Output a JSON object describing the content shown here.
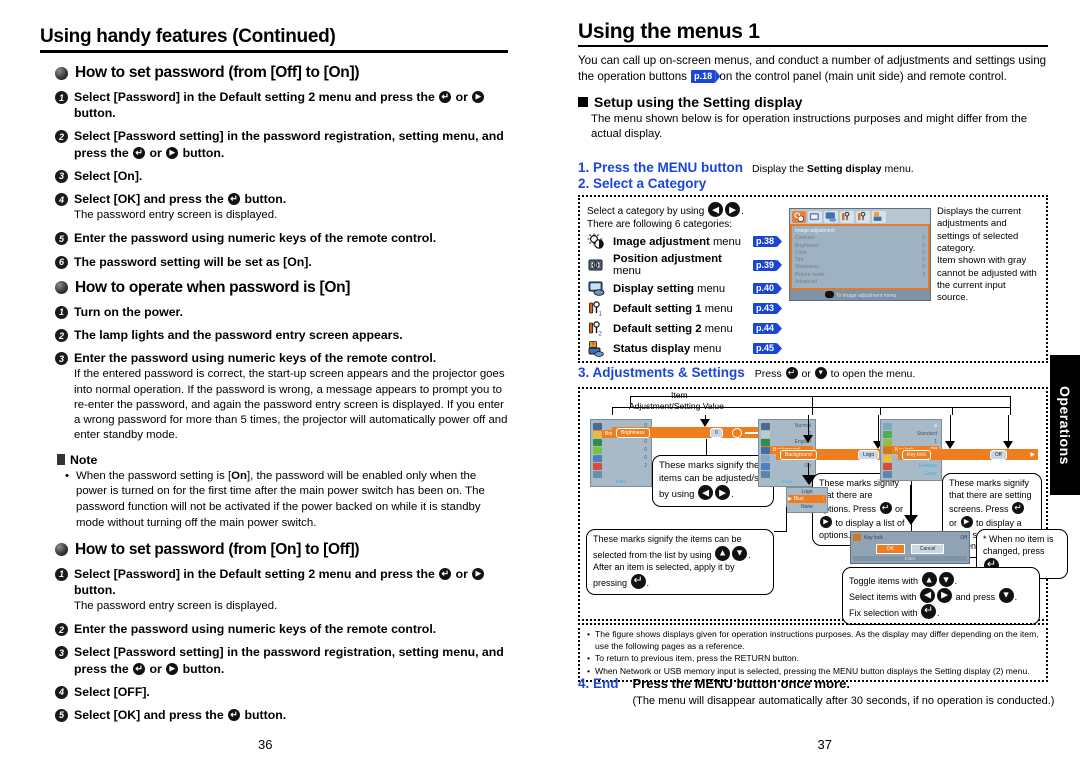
{
  "left_page": {
    "chapter_title": "Using handy features (Continued)",
    "sections": [
      {
        "heading": "How to set password (from [Off] to [On])",
        "steps": [
          {
            "num": "1",
            "text": "Select [Password] in the Default setting 2 menu and press the ⏎ or ▶ button.",
            "sub": ""
          },
          {
            "num": "2",
            "text": "Select [Password setting] in the password registration, setting menu, and press the ⏎ or ▶ button.",
            "sub": ""
          },
          {
            "num": "3",
            "text": "Select [On].",
            "sub": ""
          },
          {
            "num": "4",
            "text": "Select [OK] and press the ⏎ button.",
            "sub": "The password entry screen is displayed."
          },
          {
            "num": "5",
            "text": "Enter the password using numeric keys of the remote control.",
            "sub": ""
          },
          {
            "num": "6",
            "text": "The password setting will be set as [On].",
            "sub": ""
          }
        ]
      },
      {
        "heading": "How to operate when password is [On]",
        "steps": [
          {
            "num": "1",
            "text": "Turn on the power.",
            "sub": ""
          },
          {
            "num": "2",
            "text": "The lamp lights and the password entry screen appears.",
            "sub": ""
          },
          {
            "num": "3",
            "text": "Enter the password using numeric keys of the remote control.",
            "sub": "If the entered password is correct, the start-up screen appears and the projector goes into normal operation. If the password is wrong, a message appears to prompt you to re-enter the password, and again the password entry screen is displayed. If you enter a wrong password for more than 5 times, the projector will automatically power off and enter standby mode."
          }
        ]
      },
      {
        "heading": "How to set password (from [On] to [Off])",
        "steps": [
          {
            "num": "1",
            "text": "Select [Password] in the Default setting 2 menu and press the ⏎ or ▶ button.",
            "sub": "The password entry screen is displayed."
          },
          {
            "num": "2",
            "text": "Enter the password using numeric keys of the remote control.",
            "sub": ""
          },
          {
            "num": "3",
            "text": "Select [Password setting] in the password registration, setting menu, and press the ⏎ or ▶ button.",
            "sub": ""
          },
          {
            "num": "4",
            "text": "Select [OFF].",
            "sub": ""
          },
          {
            "num": "5",
            "text": "Select [OK] and press the ⏎ button.",
            "sub": ""
          }
        ]
      }
    ],
    "note": {
      "label": "Note",
      "items": [
        "When the password setting is [On], the password will be enabled only when the power is turned on for the first time after the main power switch has been on. The password function will not be activated if the power backed on while it is standby mode without turning off the main power switch."
      ]
    },
    "folio": "36"
  },
  "right_page": {
    "title": "Using the menus 1",
    "intro_a": "You can call up on-screen menus, and conduct a number of adjustments and settings using the operation buttons",
    "intro_badge": "p.18",
    "intro_b": "on the control panel (main unit side) and remote control.",
    "setup_heading": "Setup using the Setting display",
    "setup_sub": "The menu shown below is for operation instructions purposes and might differ from the actual display.",
    "step1": {
      "num": "1. Press the MENU button",
      "desc_a": "Display the",
      "desc_b": "Setting display",
      "desc_c": "menu."
    },
    "step2": {
      "num": "2. Select a Category"
    },
    "category_box": {
      "line1_a": "Select a category by using",
      "line1_b": ".",
      "line2": "There are following 6 categories:",
      "categories": [
        {
          "name": "Image adjustment",
          "suffix": "menu",
          "page": "p.38",
          "icon": "image-adjustment-icon"
        },
        {
          "name": "Position adjustment",
          "suffix": "menu",
          "page": "p.39",
          "icon": "position-adjustment-icon"
        },
        {
          "name": "Display setting",
          "suffix": "menu",
          "page": "p.40",
          "icon": "display-setting-icon"
        },
        {
          "name": "Default setting 1",
          "suffix": "menu",
          "page": "p.43",
          "icon": "default-setting-1-icon"
        },
        {
          "name": "Default setting 2",
          "suffix": "menu",
          "page": "p.44",
          "icon": "default-setting-2-icon"
        },
        {
          "name": "Status display",
          "suffix": "menu",
          "page": "p.45",
          "icon": "status-display-icon"
        }
      ],
      "right_note": "Displays the current adjustments and settings of selected category.\nItem shown with gray cannot be adjusted with the current input source."
    },
    "osd_mock": {
      "title": "Image adjustment",
      "rows": [
        {
          "label": "Contrast",
          "value": "0"
        },
        {
          "label": "Brightness",
          "value": "0"
        },
        {
          "label": "Color",
          "value": "0"
        },
        {
          "label": "Tint",
          "value": "0"
        },
        {
          "label": "Sharpness",
          "value": "0"
        },
        {
          "label": "Picture mode",
          "value": "2"
        },
        {
          "label": "Advanced",
          "value": ""
        }
      ],
      "footer": "To Image adjustment menu"
    },
    "step3": {
      "num": "3. Adjustments & Settings",
      "desc_a": "Press",
      "desc_b": "or",
      "desc_c": "to open the menu."
    },
    "diagram": {
      "label_item": "Item",
      "label_value": "Adjustment/Setting Value",
      "panel1": {
        "rows": [
          {
            "label": "",
            "value": "0"
          },
          {
            "label": "Brightness",
            "value": "0",
            "selected": true
          },
          {
            "label": "",
            "value": "0"
          },
          {
            "label": "",
            "value": "0"
          },
          {
            "label": "",
            "value": "0"
          },
          {
            "label": "",
            "value": "2"
          }
        ],
        "footer": "Enter",
        "chip": "Brightness",
        "value_chip": "0"
      },
      "panel2": {
        "rows": [
          {
            "label": "",
            "value": "Normal"
          },
          {
            "label": "",
            "value": "0"
          },
          {
            "label": "",
            "value": "English"
          },
          {
            "label": "Background",
            "value": "",
            "selected": true
          },
          {
            "label": "",
            "value": "On"
          },
          {
            "label": "",
            "value": "On"
          }
        ],
        "footer": "Enter",
        "chip": "Background",
        "value_chip": "Logo"
      },
      "panel3": {
        "rows": [
          {
            "label": "",
            "value": ""
          },
          {
            "label": "",
            "value": "Standard"
          },
          {
            "label": "",
            "value": "1"
          },
          {
            "label": "Key lock",
            "value": "Off",
            "selected": true
          },
          {
            "label": "",
            "value": "Standard"
          },
          {
            "label": "",
            "value": "Execute"
          },
          {
            "label": "",
            "value": "Enter"
          }
        ],
        "chip": "Key lock",
        "value_chip": "Off"
      },
      "dropdown": {
        "title": "Logo",
        "options": [
          "Blue",
          "None"
        ],
        "selected": "Blue"
      },
      "dialog": {
        "title": "Key lock",
        "value": "Off",
        "ok": "OK",
        "cancel": "Cancel",
        "footer": "Enter"
      },
      "callouts": {
        "adjust": "These marks signify the items can be adjusted/set by using",
        "options": "These marks signify that there are options. Press ⏎ or ▶ to display a list of options.",
        "screens": "These marks signify that there are setting screens. Press ⏎ or ▶ to display a list of setting screens.",
        "list_a": "These marks signify the items can be selected from the list by using",
        "list_b": "After an item is selected, apply it by pressing",
        "nochange": "* When no item is changed, press",
        "toggle_a": "Toggle items with",
        "toggle_b": "Select items with",
        "toggle_b2": "and press",
        "toggle_c": "Fix selection with"
      }
    },
    "bottom_notes": [
      "The figure shows displays given for operation instructions purposes.  As the display may differ depending on the item, use the following pages as a reference.",
      "To return to previous item, press the RETURN button.",
      "When Network or USB memory input is selected, pressing the MENU button displays the Setting display (2) menu."
    ],
    "step4": {
      "num": "4. End",
      "text": "Press the MENU button once more.",
      "sub": "(The menu will disappear automatically after 30 seconds, if no operation is conducted.)"
    },
    "side_tab": "Operations",
    "folio": "37"
  }
}
